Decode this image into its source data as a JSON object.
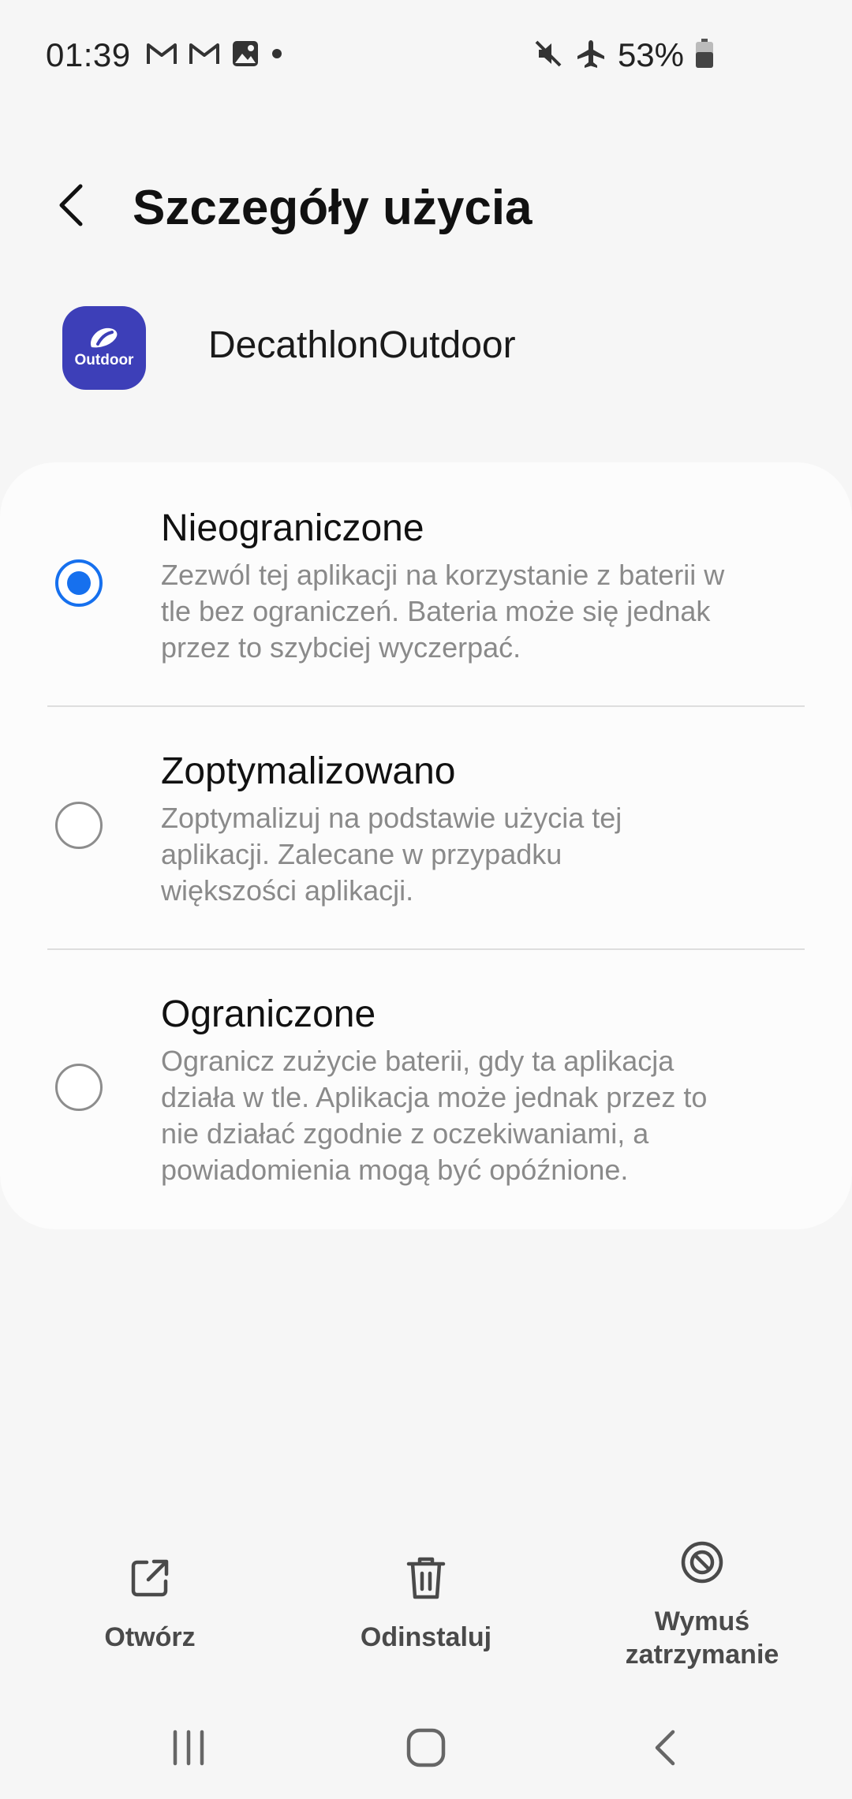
{
  "status_bar": {
    "time": "01:39",
    "battery": "53%",
    "left_icons": [
      "gmail-icon",
      "gmail-icon",
      "gallery-icon",
      "dot-icon"
    ],
    "right_icons": [
      "mute-icon",
      "airplane-icon",
      "battery-icon"
    ]
  },
  "header": {
    "title": "Szczegóły użycia"
  },
  "app": {
    "name": "DecathlonOutdoor",
    "icon_label": "Outdoor",
    "icon_color": "#3d3fb8"
  },
  "options": [
    {
      "title": "Nieograniczone",
      "description": "Zezwól tej aplikacji na korzystanie z baterii w tle bez ograniczeń. Bateria może się jednak przez to szybciej wyczerpać.",
      "selected": true
    },
    {
      "title": "Zoptymalizowano",
      "description": "Zoptymalizuj na podstawie użycia tej aplikacji. Zalecane w przypadku większości aplikacji.",
      "selected": false
    },
    {
      "title": "Ograniczone",
      "description": "Ogranicz zużycie baterii, gdy ta aplikacja działa w tle. Aplikacja może jednak przez to nie działać zgodnie z oczekiwaniami, a powiadomienia mogą być opóźnione.",
      "selected": false
    }
  ],
  "actions": {
    "open": "Otwórz",
    "uninstall": "Odinstaluj",
    "force_stop_line1": "Wymuś",
    "force_stop_line2": "zatrzymanie"
  },
  "colors": {
    "accent": "#1670ee",
    "background": "#f6f6f6",
    "card": "#fcfcfc"
  }
}
